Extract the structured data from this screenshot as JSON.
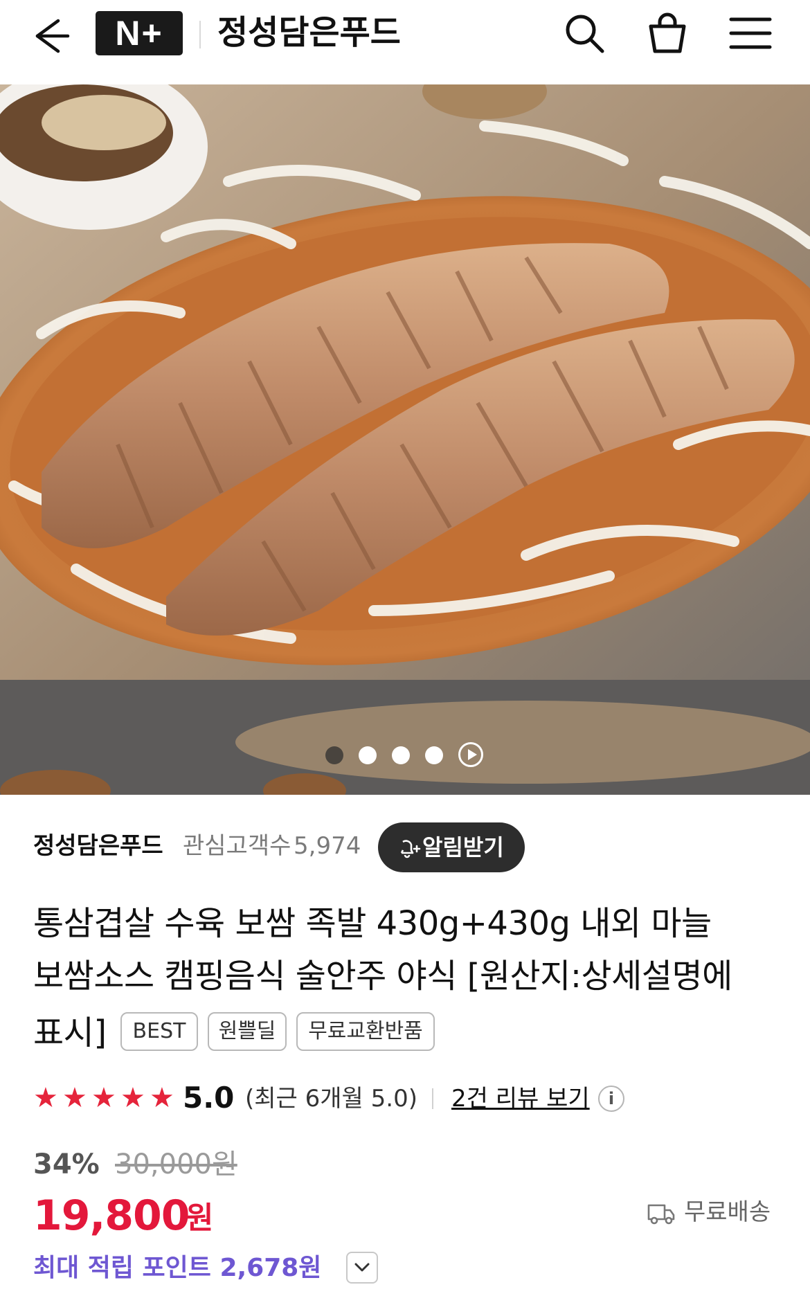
{
  "header": {
    "logo_text": "N+",
    "store_name": "정성담은푸드",
    "icons": [
      "back-arrow-icon",
      "search-icon",
      "shopping-bag-icon",
      "hamburger-menu-icon"
    ]
  },
  "gallery": {
    "image_subject": "photo",
    "slide_count": 4,
    "active_slide": 1
  },
  "seller": {
    "name": "정성담은푸드",
    "fans_label": "관심고객수",
    "fans_count": "5,974",
    "alarm_button": "알림받기"
  },
  "product": {
    "title_lines": [
      "통삼겹살 수육 보쌈 족발 430g+430g 내외 마늘",
      "보쌈소스 캠핑음식 술안주 야식 [원산지:상세설명에",
      "표시]"
    ],
    "badges": [
      "BEST",
      "원쁠딜",
      "무료교환반품"
    ]
  },
  "rating": {
    "stars": 5,
    "value": "5.0",
    "recent": "(최근 6개월 5.0)",
    "review_link": "2건 리뷰 보기",
    "info_icon": "i"
  },
  "price": {
    "discount": "34%",
    "original": "30,000원",
    "sale": "19,800",
    "currency": "원",
    "delivery": "무료배송"
  },
  "points": {
    "label": "최대 적립 포인트 2,678원"
  },
  "colors": {
    "accent_red": "#e3183b",
    "points_purple": "#6e57d2",
    "star_red": "#e5243b",
    "button_dark": "#2d2d2d"
  }
}
